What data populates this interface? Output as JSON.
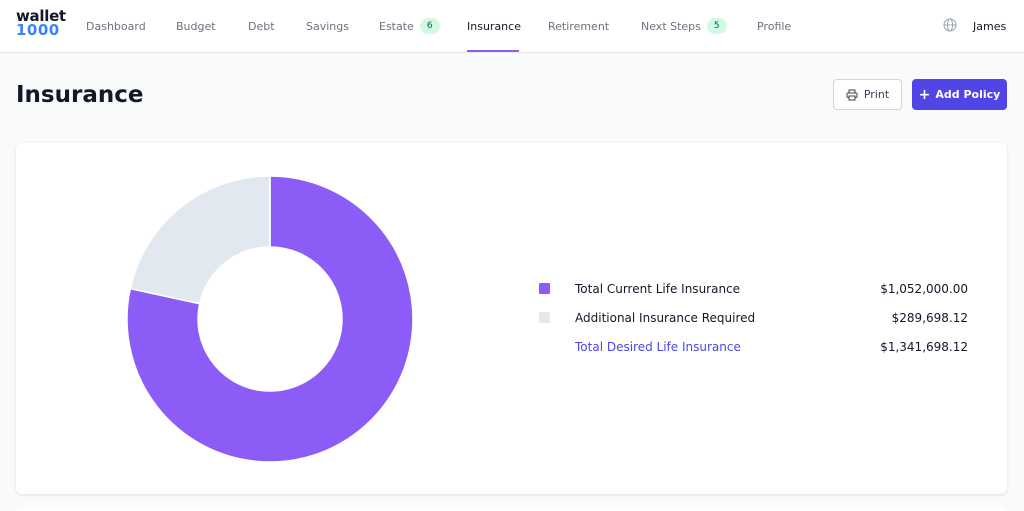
{
  "app": {
    "logo_line1": "wallet",
    "logo_line2": "1000"
  },
  "nav": {
    "items": [
      {
        "label": "Dashboard"
      },
      {
        "label": "Budget"
      },
      {
        "label": "Debt"
      },
      {
        "label": "Savings"
      },
      {
        "label": "Estate",
        "badge": "6"
      },
      {
        "label": "Insurance"
      },
      {
        "label": "Retirement"
      },
      {
        "label": "Next Steps",
        "badge": "5"
      },
      {
        "label": "Profile"
      }
    ],
    "active": "Insurance"
  },
  "user": {
    "name": "James",
    "globe_icon": "globe-icon"
  },
  "header": {
    "title": "Insurance",
    "print_label": "Print",
    "print_icon": "printer-icon",
    "add_label": "Add Policy",
    "add_icon": "plus-icon"
  },
  "colors": {
    "accent": "#4f46e5",
    "current": "#8b5cf6",
    "additional": "#e2e8f0",
    "badge_bg": "#d1fae5"
  },
  "chart_data": {
    "type": "pie",
    "donut": true,
    "categories": [
      "Total Current Life Insurance",
      "Additional Insurance Required"
    ],
    "values": [
      1052000.0,
      289698.12
    ],
    "colors": [
      "#8b5cf6",
      "#e2e8f0"
    ],
    "total_label": "Total Desired Life Insurance",
    "total_value": 1341698.12
  },
  "legend": {
    "rows": [
      {
        "label": "Total Current Life Insurance",
        "value": "$1,052,000.00"
      },
      {
        "label": "Additional Insurance Required",
        "value": "$289,698.12"
      },
      {
        "label": "Total Desired Life Insurance",
        "value": "$1,341,698.12"
      }
    ]
  }
}
